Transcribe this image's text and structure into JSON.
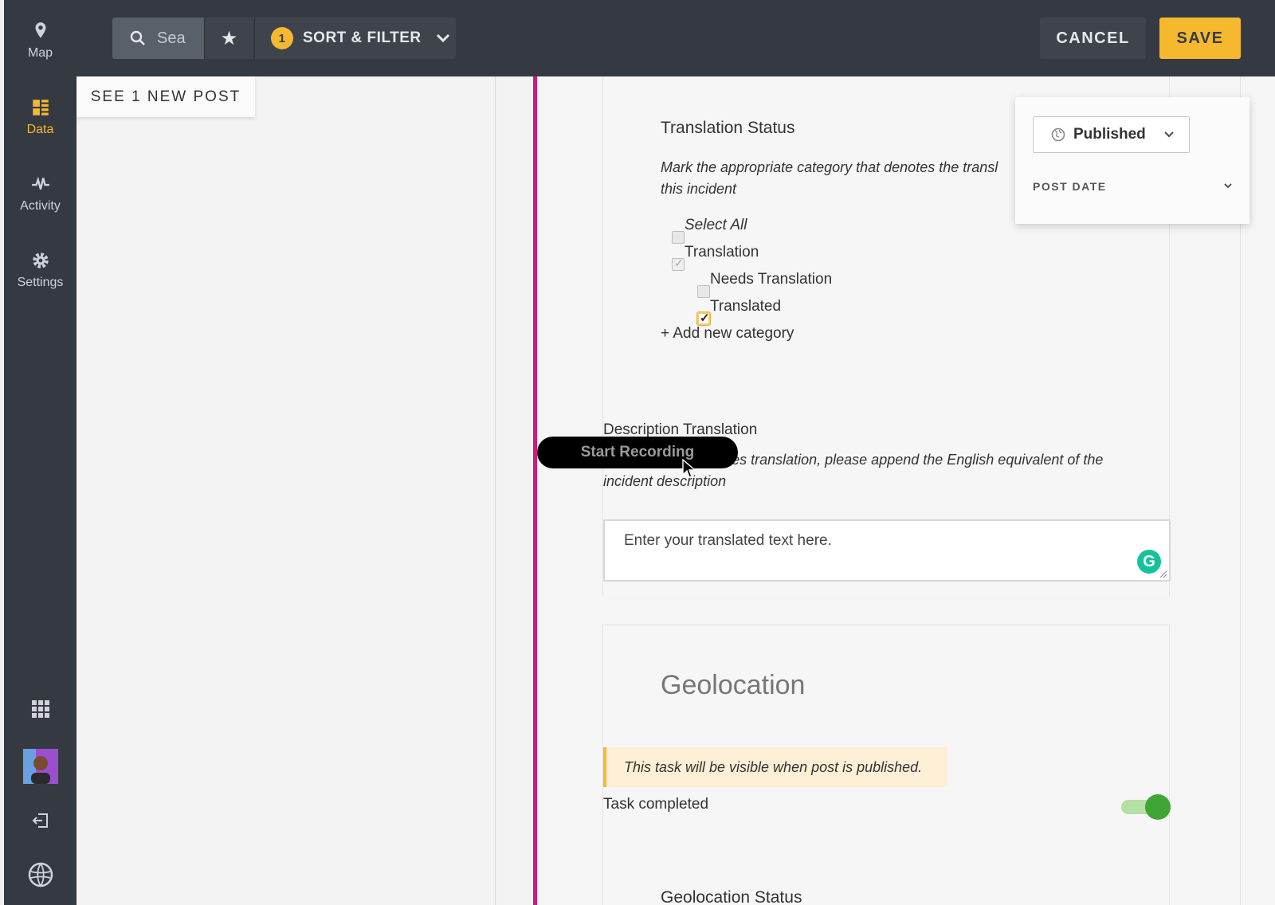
{
  "nav": {
    "items": [
      {
        "label": "Map",
        "icon": "map-pin-icon"
      },
      {
        "label": "Data",
        "icon": "data-icon",
        "active": true
      },
      {
        "label": "Activity",
        "icon": "activity-icon"
      },
      {
        "label": "Settings",
        "icon": "gear-icon"
      }
    ],
    "bottom_icons": [
      "apps-grid-icon",
      "user-avatar",
      "logout-icon",
      "ushahidi-logo-icon"
    ]
  },
  "topbar": {
    "search_placeholder": "Sea",
    "sort_filter_count": "1",
    "sort_filter_label": "SORT & FILTER",
    "cancel_label": "CANCEL",
    "save_label": "SAVE"
  },
  "list": {
    "new_post_label": "SEE 1 NEW POST"
  },
  "translation_status": {
    "title": "Translation Status",
    "help": "Mark the appropriate category that denotes the transl",
    "help_line2": "this incident",
    "options": [
      {
        "label": "Select All",
        "italic": true,
        "checked": false
      },
      {
        "label": "Translation",
        "checked": true,
        "dim": true
      },
      {
        "label": "Needs Translation",
        "checked": false
      },
      {
        "label": "Translated",
        "checked": true
      }
    ],
    "add_category": "+ Add new category"
  },
  "description_translation": {
    "title": "Description Translation",
    "help_line1": "If this incident requires translation, please append the English equivalent of the",
    "help_line2": "incident description",
    "placeholder": "Enter your translated text here."
  },
  "geolocation": {
    "title": "Geolocation",
    "notice": "This task will be visible when post is published.",
    "task_completed_label": "Task completed",
    "task_completed": true,
    "status_title": "Geolocation Status"
  },
  "status_panel": {
    "status": "Published",
    "post_date_label": "POST DATE"
  },
  "overlay": {
    "recording_label": "Start Recording"
  },
  "colors": {
    "accent": "#f5b82e",
    "nav_bg": "#353a42",
    "magenta": "#d0197c",
    "toggle_on": "#3fa535"
  }
}
